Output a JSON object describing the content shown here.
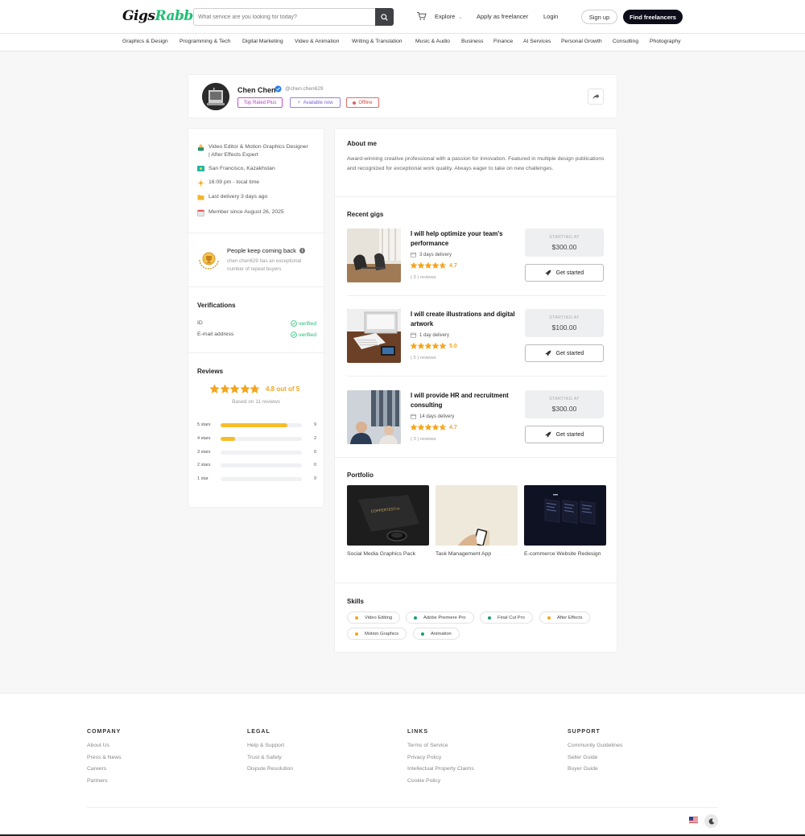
{
  "brand": {
    "part1": "Gigs",
    "part2": "Rabbit"
  },
  "header": {
    "search_placeholder": "What service are you looking for today?",
    "explore": "Explore",
    "apply": "Apply as freelancer",
    "login": "Login",
    "signup": "Sign up",
    "find": "Find freelancers"
  },
  "categories": [
    "Graphics & Design",
    "Programming & Tech",
    "Digital Marketing",
    "Video & Animation",
    "Writing & Translation",
    "Music & Audio",
    "Business",
    "Finance",
    "AI Services",
    "Personal Growth",
    "Consulting",
    "Photography"
  ],
  "profile": {
    "name": "Chen Chen",
    "handle": "@chen.chen629",
    "tags": [
      "Top Rated Plus",
      "Available now",
      "Offline"
    ],
    "title": "Video Editor & Motion Graphics Designer | After Effects Expert",
    "location": "San Francisco,  Kazakhstan",
    "local_time": "16:09 pm - local time",
    "last_delivery": "Last delivery 3 days ago",
    "member_since": "Member since August 26, 2025",
    "repeat_title": "People keep coming back",
    "repeat_desc": "chen.chen629 has an exceptional number of repeat buyers"
  },
  "verifications": {
    "title": "Verifications",
    "items": [
      {
        "label": "ID",
        "status": "verified"
      },
      {
        "label": "E-mail address",
        "status": "verified"
      }
    ]
  },
  "reviews": {
    "title": "Reviews",
    "rating": 4.8,
    "rating_text": "4.8 out of 5",
    "based_on": "Based on 11 reviews",
    "bars": [
      {
        "label": "5 stars",
        "count": 9,
        "fraction": 0.818
      },
      {
        "label": "4 stars",
        "count": 2,
        "fraction": 0.182
      },
      {
        "label": "3 stars",
        "count": 0,
        "fraction": 0
      },
      {
        "label": "2 stars",
        "count": 0,
        "fraction": 0
      },
      {
        "label": "1 star",
        "count": 0,
        "fraction": 0
      }
    ]
  },
  "about": {
    "title": "About me",
    "text": "Award-winning creative professional with a passion for innovation. Featured in multiple design publications and recognized for exceptional work quality. Always eager to take on new challenges."
  },
  "gigs_title": "Recent gigs",
  "gigs": [
    {
      "title": "I will help optimize your team's performance",
      "delivery": "3 days delivery",
      "rating": "4.7",
      "rating_value": 4.7,
      "reviews": "( 3 ) reviews",
      "price_label": "STARTING AT",
      "price": "$300.00",
      "cta": "Get started"
    },
    {
      "title": "I will create illustrations and digital artwork",
      "delivery": "1 day delivery",
      "rating": "5.0",
      "rating_value": 5.0,
      "reviews": "( 5 ) reviews",
      "price_label": "STARTING AT",
      "price": "$100.00",
      "cta": "Get started"
    },
    {
      "title": "I will provide HR and recruitment consulting",
      "delivery": "14 days delivery",
      "rating": "4.7",
      "rating_value": 4.7,
      "reviews": "( 3 ) reviews",
      "price_label": "STARTING AT",
      "price": "$300.00",
      "cta": "Get started"
    }
  ],
  "portfolio": {
    "title": "Portfolio",
    "items": [
      "Social Media Graphics Pack",
      "Task Management App",
      "E-commerce Website Redesign"
    ]
  },
  "skills": {
    "title": "Skills",
    "items": [
      {
        "name": "Video Editing",
        "color": "#f4a51d"
      },
      {
        "name": "Adobe Premiere Pro",
        "color": "#1a9e6e"
      },
      {
        "name": "Final Cut Pro",
        "color": "#1a9e6e"
      },
      {
        "name": "After Effects",
        "color": "#f4a51d"
      },
      {
        "name": "Motion Graphics",
        "color": "#f4a51d"
      },
      {
        "name": "Animation",
        "color": "#1a9e6e"
      }
    ]
  },
  "footer": {
    "columns": [
      {
        "title": "COMPANY",
        "links": [
          "About Us",
          "Press & News",
          "Careers",
          "Partners"
        ]
      },
      {
        "title": "LEGAL",
        "links": [
          "Help & Support",
          "Trust & Safety",
          "Dispute Resolution"
        ]
      },
      {
        "title": "LINKS",
        "links": [
          "Terms of Service",
          "Privacy Policy",
          "Intellectual Property Claims",
          "Cookie Policy"
        ]
      },
      {
        "title": "SUPPORT",
        "links": [
          "Community Guidelines",
          "Seller Guide",
          "Buyer Guide"
        ]
      }
    ]
  },
  "colors": {
    "accent": "#1dbf73",
    "star": "#f4a51d",
    "dark": "#0e0e1a"
  }
}
